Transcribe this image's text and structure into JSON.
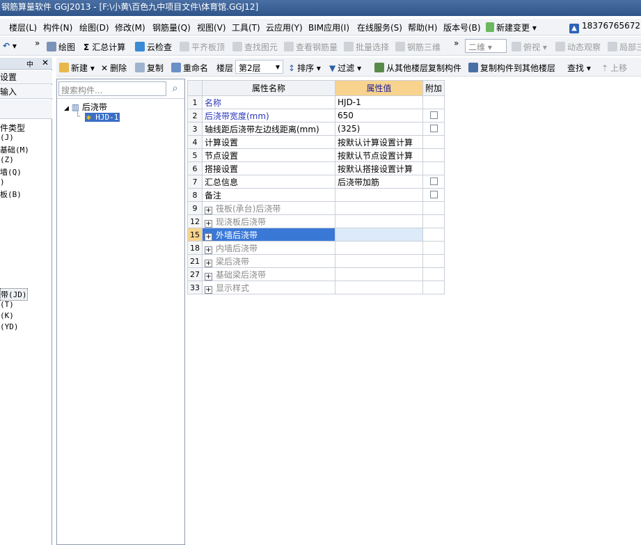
{
  "window": {
    "title": "钢筋算量软件 GGJ2013 - [F:\\小黄\\百色九中项目文件\\体育馆.GGJ12]"
  },
  "menu": {
    "items": [
      "楼层(L)",
      "构件(N)",
      "绘图(D)",
      "修改(M)",
      "钢筋量(Q)",
      "视图(V)",
      "工具(T)",
      "云应用(Y)",
      "BIM应用(I)",
      "在线服务(S)",
      "帮助(H)",
      "版本号(B)"
    ],
    "new_change": "新建变更",
    "phone": "18376765672"
  },
  "toolbar1": {
    "draw": "绘图",
    "sum_calc": "汇总计算",
    "cloud_check": "云检查",
    "flush_slab": "平齐板顶",
    "find_element": "查找图元",
    "view_rebar": "查看钢筋量",
    "batch_select": "批量选择",
    "rebar_3d": "钢筋三维",
    "view_mode": "二维",
    "top_view": "俯视",
    "dynamic_view": "动态观察",
    "local": "局部三"
  },
  "toolbar2": {
    "new": "新建",
    "delete": "删除",
    "copy": "复制",
    "rename": "重命名",
    "floor_label": "楼层",
    "floor_value": "第2层",
    "sort": "排序",
    "filter": "过滤",
    "copy_from_other": "从其他楼层复制构件",
    "copy_to_other": "复制构件到其他楼层",
    "find": "查找",
    "move_up": "上移"
  },
  "left_panel": {
    "rows": [
      "设置",
      "输入"
    ],
    "items": [
      "件类型",
      "(J)",
      "基础(M)",
      "(Z)",
      "墙(Q)",
      ")",
      "板(B)",
      "带(JD)",
      "(T)",
      "(K)",
      "(YD)"
    ]
  },
  "tree": {
    "search_placeholder": "搜索构件...",
    "root": "后浇带",
    "child": "HJD-1"
  },
  "grid": {
    "headers": {
      "name": "属性名称",
      "value": "属性值",
      "extra": "附加"
    },
    "rows": [
      {
        "num": "1",
        "name": "名称",
        "value": "HJD-1"
      },
      {
        "num": "2",
        "name": "后浇带宽度(mm)",
        "value": "650"
      },
      {
        "num": "3",
        "name": "轴线距后浇带左边线距离(mm)",
        "value": "(325)"
      },
      {
        "num": "4",
        "name": "计算设置",
        "value": "按默认计算设置计算"
      },
      {
        "num": "5",
        "name": "节点设置",
        "value": "按默认节点设置计算"
      },
      {
        "num": "6",
        "name": "搭接设置",
        "value": "按默认搭接设置计算"
      },
      {
        "num": "7",
        "name": "汇总信息",
        "value": "后浇带加筋"
      },
      {
        "num": "8",
        "name": "备注",
        "value": ""
      },
      {
        "num": "9",
        "name": "筏板(承台)后浇带",
        "value": ""
      },
      {
        "num": "12",
        "name": "现浇板后浇带",
        "value": ""
      },
      {
        "num": "15",
        "name": "外墙后浇带",
        "value": ""
      },
      {
        "num": "18",
        "name": "内墙后浇带",
        "value": ""
      },
      {
        "num": "21",
        "name": "梁后浇带",
        "value": ""
      },
      {
        "num": "27",
        "name": "基础梁后浇带",
        "value": ""
      },
      {
        "num": "33",
        "name": "显示样式",
        "value": ""
      }
    ]
  }
}
